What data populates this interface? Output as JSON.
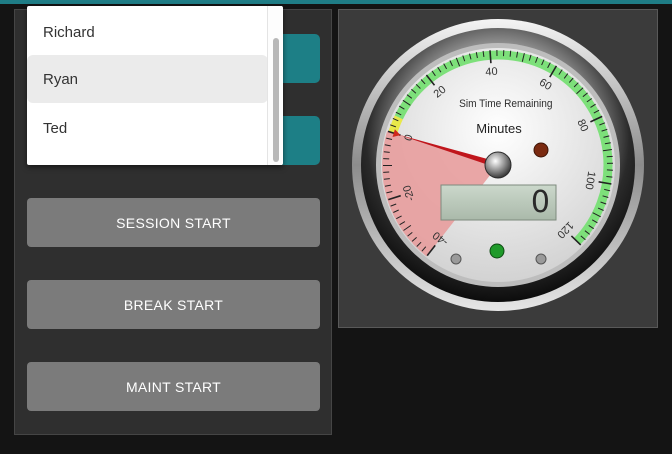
{
  "dropdown": {
    "items": [
      {
        "label": "Richard",
        "selected": false
      },
      {
        "label": "Ryan",
        "selected": true
      },
      {
        "label": "Ted",
        "selected": false
      }
    ]
  },
  "buttons": {
    "session_start": "SESSION START",
    "break_start": "BREAK START",
    "maint_start": "MAINT START"
  },
  "gauge": {
    "title": "Sim Time Remaining",
    "units": "Minutes",
    "readout": "0",
    "value": 0,
    "scale_min": -40,
    "scale_max": 120,
    "ticks": [
      "-40",
      "-20",
      "0",
      "20",
      "40",
      "60",
      "80",
      "100",
      "120"
    ],
    "colors": {
      "danger_zone": "#e89d9d",
      "green_band": "#7de07a",
      "yellow_band": "#e8e84a",
      "needle": "#c0161c",
      "led_dark_red": "#7a2a10",
      "led_green": "#1f9a2a"
    }
  }
}
